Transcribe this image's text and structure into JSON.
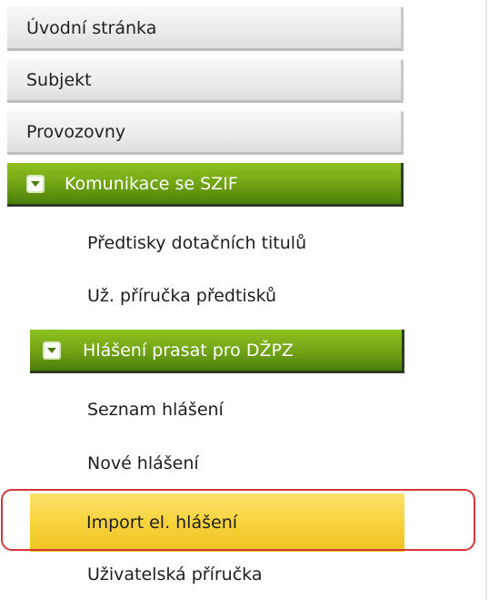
{
  "menu": {
    "top_items": [
      {
        "label": "Úvodní stránka"
      },
      {
        "label": "Subjekt"
      },
      {
        "label": "Provozovny"
      }
    ],
    "section": {
      "label": "Komunikace se SZIF",
      "icon": "chevron-down-icon",
      "links": [
        {
          "label": "Předtisky dotačních titulů"
        },
        {
          "label": "Už. příručka předtisků"
        }
      ],
      "subsection": {
        "label": "Hlášení prasat pro DŽPZ",
        "icon": "chevron-down-icon",
        "links": [
          {
            "label": "Seznam hlášení"
          },
          {
            "label": "Nové hlášení"
          },
          {
            "label": "Import el. hlášení",
            "selected": true
          },
          {
            "label": "Uživatelská příručka"
          }
        ]
      }
    }
  },
  "colors": {
    "green_accent": "#6fa214",
    "selected_background": "#f7d33c",
    "highlight_outline": "#d4373a"
  }
}
